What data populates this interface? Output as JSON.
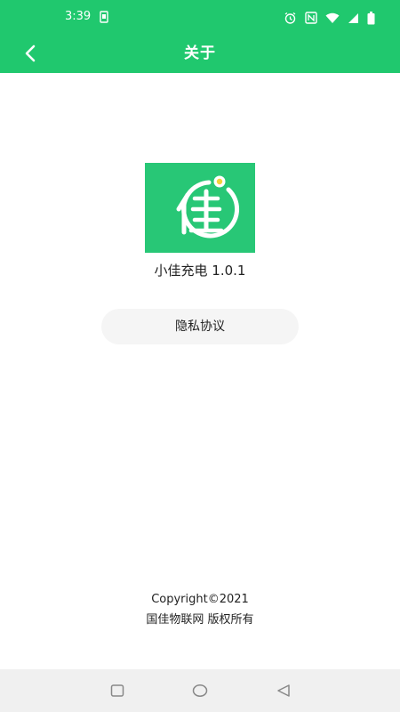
{
  "status_bar": {
    "time": "3:39",
    "icons": [
      "sim-icon",
      "alarm-icon",
      "nfc-icon",
      "wifi-icon",
      "signal-icon",
      "battery-icon"
    ]
  },
  "header": {
    "title": "关于",
    "back_icon": "chevron-left-icon",
    "background_color": "#20c86e"
  },
  "app": {
    "logo_icon": "app-logo-jia-icon",
    "logo_color": "#28c776",
    "version_text": "小佳充电 1.0.1"
  },
  "actions": {
    "privacy_label": "隐私协议"
  },
  "footer": {
    "copyright": "Copyright©2021",
    "company": "国佳物联网 版权所有"
  },
  "nav_bar": {
    "icons": [
      "recents-square-icon",
      "home-circle-icon",
      "back-triangle-icon"
    ]
  }
}
